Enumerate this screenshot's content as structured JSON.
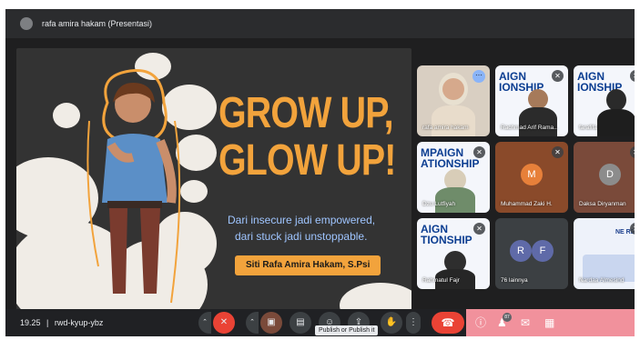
{
  "header": {
    "presenter_title": "rafa amira hakam (Presentasi)"
  },
  "slide": {
    "headline_line1": "GROW UP,",
    "headline_line2": "GLOW UP!",
    "subtitle_line1": "Dari insecure jadi empowered,",
    "subtitle_line2": "dari stuck jadi unstoppable.",
    "speaker": "Siti Rafa Amira Hakam, S.Psi"
  },
  "participants": [
    {
      "name": "rafa amira hakam"
    },
    {
      "name": "Rachmad Arif Rama..."
    },
    {
      "name": "farafifa"
    },
    {
      "name": "Dzu Lutfiyah"
    },
    {
      "name": "Muhammad Zaki H.",
      "initial": "M"
    },
    {
      "name": "Daksa Diryanman",
      "initial": "D"
    },
    {
      "name": "Rahmatul Fajr"
    },
    {
      "name": "76 lainnya",
      "initials": [
        "R",
        "F"
      ]
    },
    {
      "name": "Nardaa Almesind"
    }
  ],
  "slide_thumb_texts": {
    "t1": "AIGN\nIONSHIP",
    "t2": "AIGN\nIONSHIP",
    "t3": "MPAIGN\nATIONSHIP",
    "t4": "AIGN\nTIONSHIP",
    "t5": "NE RELA"
  },
  "bottombar": {
    "time": "19.25",
    "separator": "|",
    "meeting_code": "rwd-kyup-ybz",
    "tooltip": "Publish or Publish it",
    "participants_count": "87",
    "hangup_icon": "phone-icon"
  },
  "colors": {
    "accent_orange": "#f2a33c",
    "sub_blue": "#9fc5ff",
    "hangup_red": "#ea4335",
    "panel_pink": "#f1919c"
  }
}
